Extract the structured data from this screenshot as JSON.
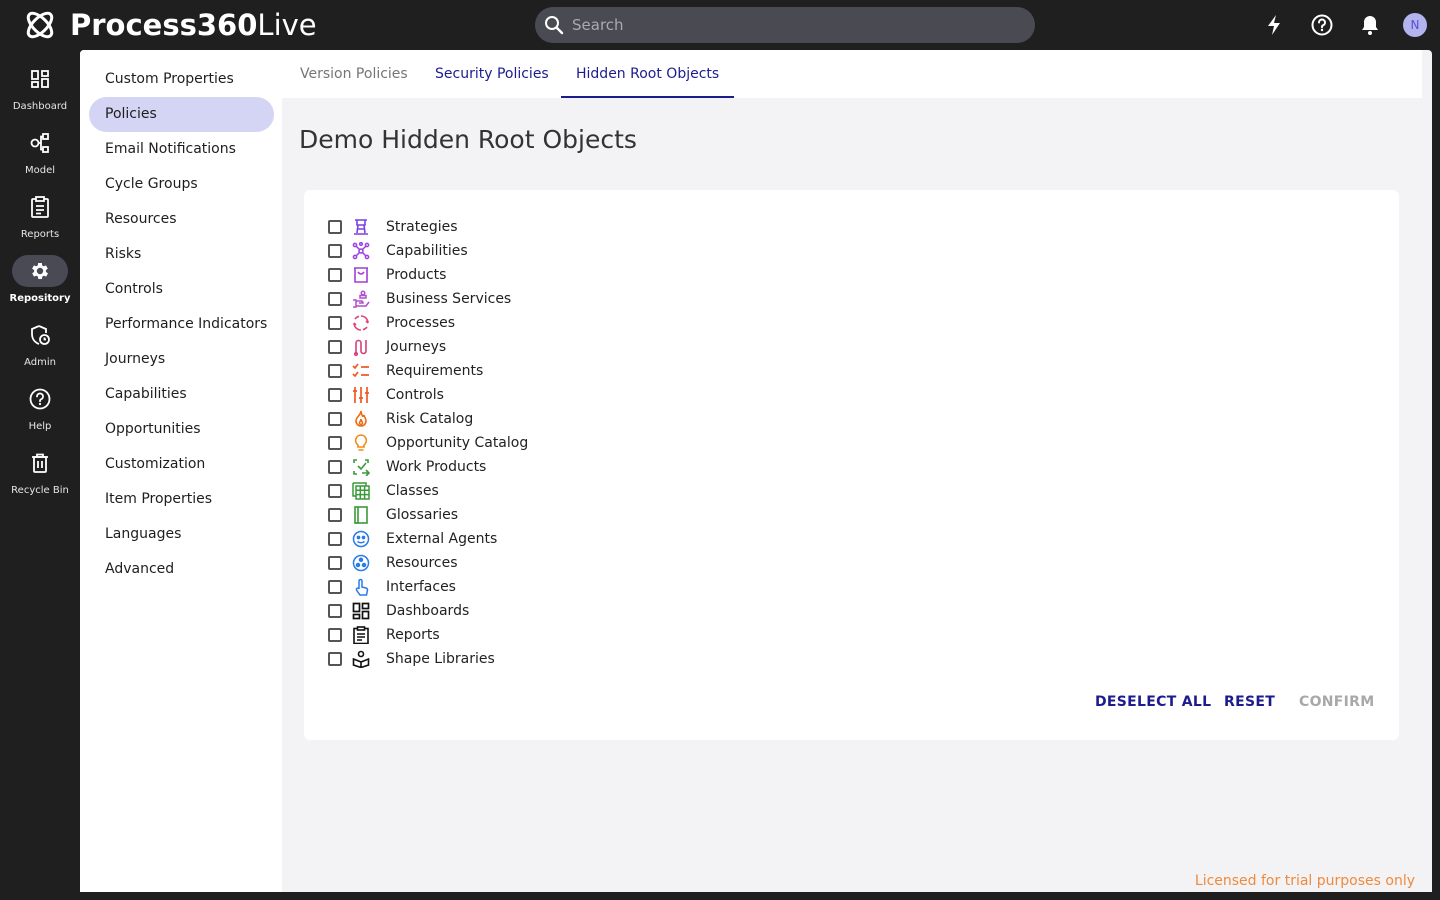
{
  "app": {
    "brand_bold": "Process360",
    "brand_light": "Live"
  },
  "search": {
    "placeholder": "Search"
  },
  "user": {
    "initial": "N"
  },
  "rail": [
    {
      "label": "Dashboard",
      "icon": "dashboard-icon"
    },
    {
      "label": "Model",
      "icon": "model-icon"
    },
    {
      "label": "Reports",
      "icon": "reports-icon"
    },
    {
      "label": "Repository",
      "icon": "gear-icon",
      "active": true
    },
    {
      "label": "Admin",
      "icon": "admin-shield-icon"
    },
    {
      "label": "Help",
      "icon": "help-icon"
    },
    {
      "label": "Recycle Bin",
      "icon": "trash-icon"
    }
  ],
  "subnav": [
    "Custom Properties",
    "Policies",
    "Email Notifications",
    "Cycle Groups",
    "Resources",
    "Risks",
    "Controls",
    "Performance Indicators",
    "Journeys",
    "Capabilities",
    "Opportunities",
    "Customization",
    "Item Properties",
    "Languages",
    "Advanced"
  ],
  "tabs": [
    "Version Policies",
    "Security Policies",
    "Hidden Root Objects"
  ],
  "page_title": "Demo Hidden Root Objects",
  "objects": [
    {
      "label": "Strategies",
      "icon": "strategy-icon",
      "color": "#7b3fe4"
    },
    {
      "label": "Capabilities",
      "icon": "capabilities-icon",
      "color": "#9b3fe4"
    },
    {
      "label": "Products",
      "icon": "products-icon",
      "color": "#a03fd4"
    },
    {
      "label": "Business Services",
      "icon": "business-services-icon",
      "color": "#b04fcf"
    },
    {
      "label": "Processes",
      "icon": "processes-icon",
      "color": "#e0457a"
    },
    {
      "label": "Journeys",
      "icon": "journeys-icon",
      "color": "#d6407a"
    },
    {
      "label": "Requirements",
      "icon": "requirements-icon",
      "color": "#ef5a24"
    },
    {
      "label": "Controls",
      "icon": "controls-icon",
      "color": "#ef5a24"
    },
    {
      "label": "Risk Catalog",
      "icon": "risk-icon",
      "color": "#ef6a10"
    },
    {
      "label": "Opportunity Catalog",
      "icon": "opportunity-icon",
      "color": "#f08a10"
    },
    {
      "label": "Work Products",
      "icon": "work-products-icon",
      "color": "#3a9a3a"
    },
    {
      "label": "Classes",
      "icon": "classes-icon",
      "color": "#3a9a3a"
    },
    {
      "label": "Glossaries",
      "icon": "glossaries-icon",
      "color": "#3a9a3a"
    },
    {
      "label": "External Agents",
      "icon": "external-agents-icon",
      "color": "#2a7ae8"
    },
    {
      "label": "Resources",
      "icon": "resources-icon",
      "color": "#2a7ae8"
    },
    {
      "label": "Interfaces",
      "icon": "interfaces-icon",
      "color": "#2a7ae8"
    },
    {
      "label": "Dashboards",
      "icon": "dashboard-icon",
      "color": "#111111"
    },
    {
      "label": "Reports",
      "icon": "reports-icon",
      "color": "#111111"
    },
    {
      "label": "Shape Libraries",
      "icon": "shape-library-icon",
      "color": "#111111"
    }
  ],
  "actions": {
    "deselect_all": "DESELECT ALL",
    "reset": "RESET",
    "confirm": "CONFIRM"
  },
  "license": "Licensed for trial purposes only",
  "colors": {
    "accent": "#1c1c8f",
    "sidebar_active": "#d4d4f4",
    "license": "#f08a3c"
  }
}
